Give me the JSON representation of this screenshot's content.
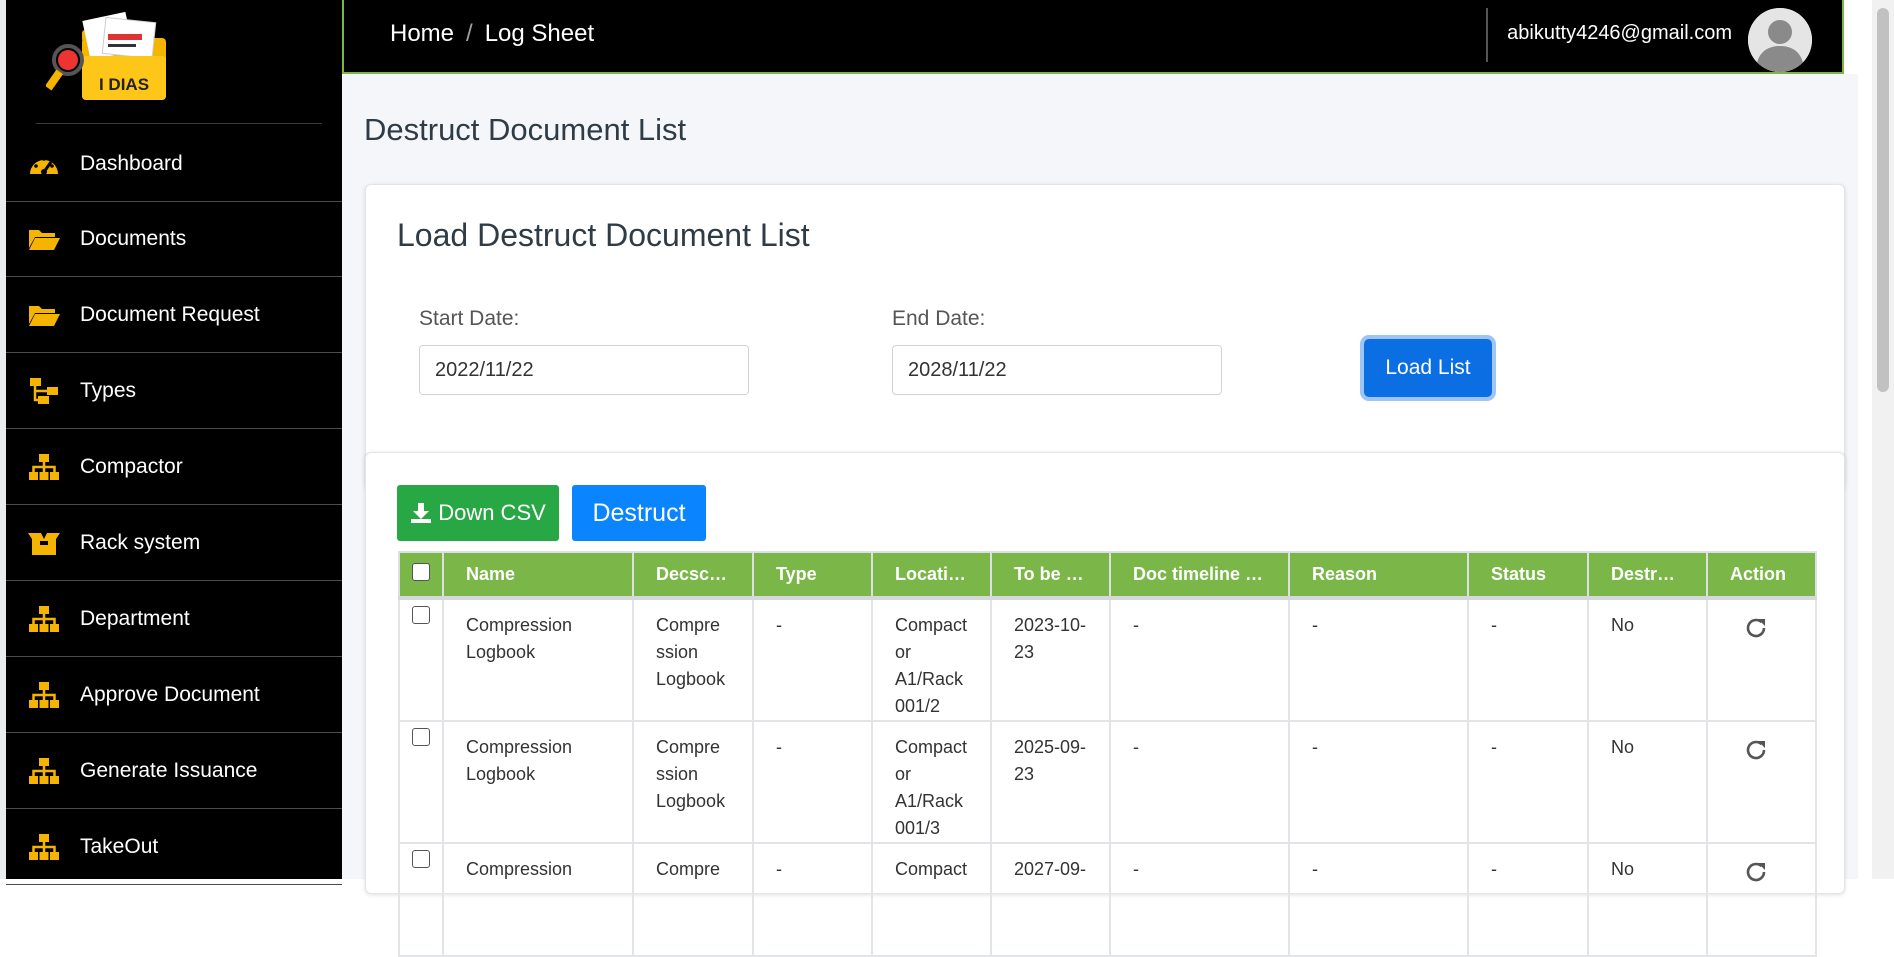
{
  "app": {
    "logo_text": "I DIAS"
  },
  "breadcrumb": {
    "home": "Home",
    "separator": "/",
    "current": "Log Sheet"
  },
  "user": {
    "email": "abikutty4246@gmail.com"
  },
  "colors": {
    "accent_green": "#7ab648",
    "primary_blue": "#0b6ee3",
    "icon_yellow": "#f5b400",
    "csv_green": "#28a745"
  },
  "sidebar": {
    "items": [
      {
        "label": "Dashboard",
        "icon": "dashboard-gauge-icon"
      },
      {
        "label": "Documents",
        "icon": "folder-open-icon"
      },
      {
        "label": "Document Request",
        "icon": "folder-open-icon"
      },
      {
        "label": "Types",
        "icon": "hierarchy-icon"
      },
      {
        "label": "Compactor",
        "icon": "sitemap-icon"
      },
      {
        "label": "Rack system",
        "icon": "open-box-icon"
      },
      {
        "label": "Department",
        "icon": "sitemap-icon"
      },
      {
        "label": "Approve Document",
        "icon": "sitemap-icon"
      },
      {
        "label": "Generate Issuance",
        "icon": "sitemap-icon"
      },
      {
        "label": "TakeOut",
        "icon": "sitemap-icon"
      }
    ]
  },
  "page": {
    "title": "Destruct Document List"
  },
  "filter": {
    "title": "Load Destruct Document List",
    "start_label": "Start Date:",
    "start_value": "2022/11/22",
    "end_label": "End Date:",
    "end_value": "2028/11/22",
    "load_button": "Load List"
  },
  "actions": {
    "csv_button": "Down CSV",
    "destruct_button": "Destruct"
  },
  "table": {
    "headers": [
      "Name",
      "Decsc…",
      "Type",
      "Locati…",
      "To be …",
      "Doc timeline …",
      "Reason",
      "Status",
      "Destr…",
      "Action"
    ],
    "rows": [
      {
        "name": "Compression Logbook",
        "desc": "Compre ssion Logbook",
        "type": "-",
        "location": "Compact or A1/Rack 001/2",
        "to_be": "2023-10-23",
        "timeline": "-",
        "reason": "-",
        "status": "-",
        "destructed": "No"
      },
      {
        "name": "Compression Logbook",
        "desc": "Compre ssion Logbook",
        "type": "-",
        "location": "Compact or A1/Rack 001/3",
        "to_be": "2025-09-23",
        "timeline": "-",
        "reason": "-",
        "status": "-",
        "destructed": "No"
      },
      {
        "name": "Compression",
        "desc": "Compre",
        "type": "-",
        "location": "Compact",
        "to_be": "2027-09-",
        "timeline": "-",
        "reason": "-",
        "status": "-",
        "destructed": "No"
      }
    ]
  }
}
